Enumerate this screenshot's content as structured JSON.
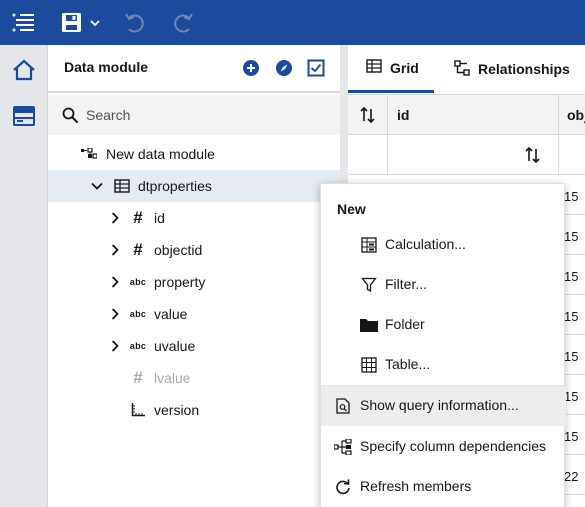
{
  "toolbar": {
    "menu_icon": "hamburger-menu-icon",
    "save_icon": "save-icon",
    "undo_icon": "undo-icon",
    "redo_icon": "redo-icon",
    "accent": "#1c4a9c"
  },
  "rail": {
    "items": [
      {
        "icon": "home-icon",
        "active": true
      },
      {
        "icon": "data-server-icon",
        "active": false
      }
    ]
  },
  "panel": {
    "title": "Data module",
    "search_placeholder": "Search",
    "tree": [
      {
        "label": "New data module",
        "icon": "data-module-icon",
        "depth": 0
      },
      {
        "label": "dtproperties",
        "icon": "table-icon",
        "depth": 1,
        "expanded": true,
        "selected": true
      },
      {
        "label": "id",
        "icon": "number-icon",
        "depth": 2,
        "chevron": true
      },
      {
        "label": "objectid",
        "icon": "number-icon",
        "depth": 2,
        "chevron": true
      },
      {
        "label": "property",
        "icon": "text-icon",
        "icon_text": "abc",
        "depth": 2,
        "chevron": true
      },
      {
        "label": "value",
        "icon": "text-icon",
        "icon_text": "abc",
        "depth": 2,
        "chevron": true
      },
      {
        "label": "uvalue",
        "icon": "text-icon",
        "icon_text": "abc",
        "depth": 2,
        "chevron": true
      },
      {
        "label": "lvalue",
        "icon": "number-icon",
        "depth": 2,
        "disabled": true
      },
      {
        "label": "version",
        "icon": "ruler-icon",
        "depth": 2
      }
    ]
  },
  "grid": {
    "tabs": [
      {
        "label": "Grid",
        "icon": "grid-icon",
        "active": true
      },
      {
        "label": "Relationships",
        "icon": "relationships-icon",
        "active": false
      }
    ],
    "columns": [
      "id",
      "obj"
    ],
    "cells": [
      "15",
      "15",
      "15",
      "15",
      "15",
      "15",
      "15",
      "22"
    ]
  },
  "context_menu": {
    "header": "New",
    "new_items": [
      {
        "label": "Calculation...",
        "icon": "calculation-icon"
      },
      {
        "label": "Filter...",
        "icon": "filter-icon"
      },
      {
        "label": "Folder",
        "icon": "folder-icon"
      },
      {
        "label": "Table...",
        "icon": "table-icon"
      }
    ],
    "items": [
      {
        "label": "Show query information...",
        "icon": "query-info-icon",
        "hover": true
      },
      {
        "label": "Specify column dependencies",
        "icon": "dependencies-icon"
      },
      {
        "label": "Refresh members",
        "icon": "refresh-icon"
      }
    ]
  }
}
